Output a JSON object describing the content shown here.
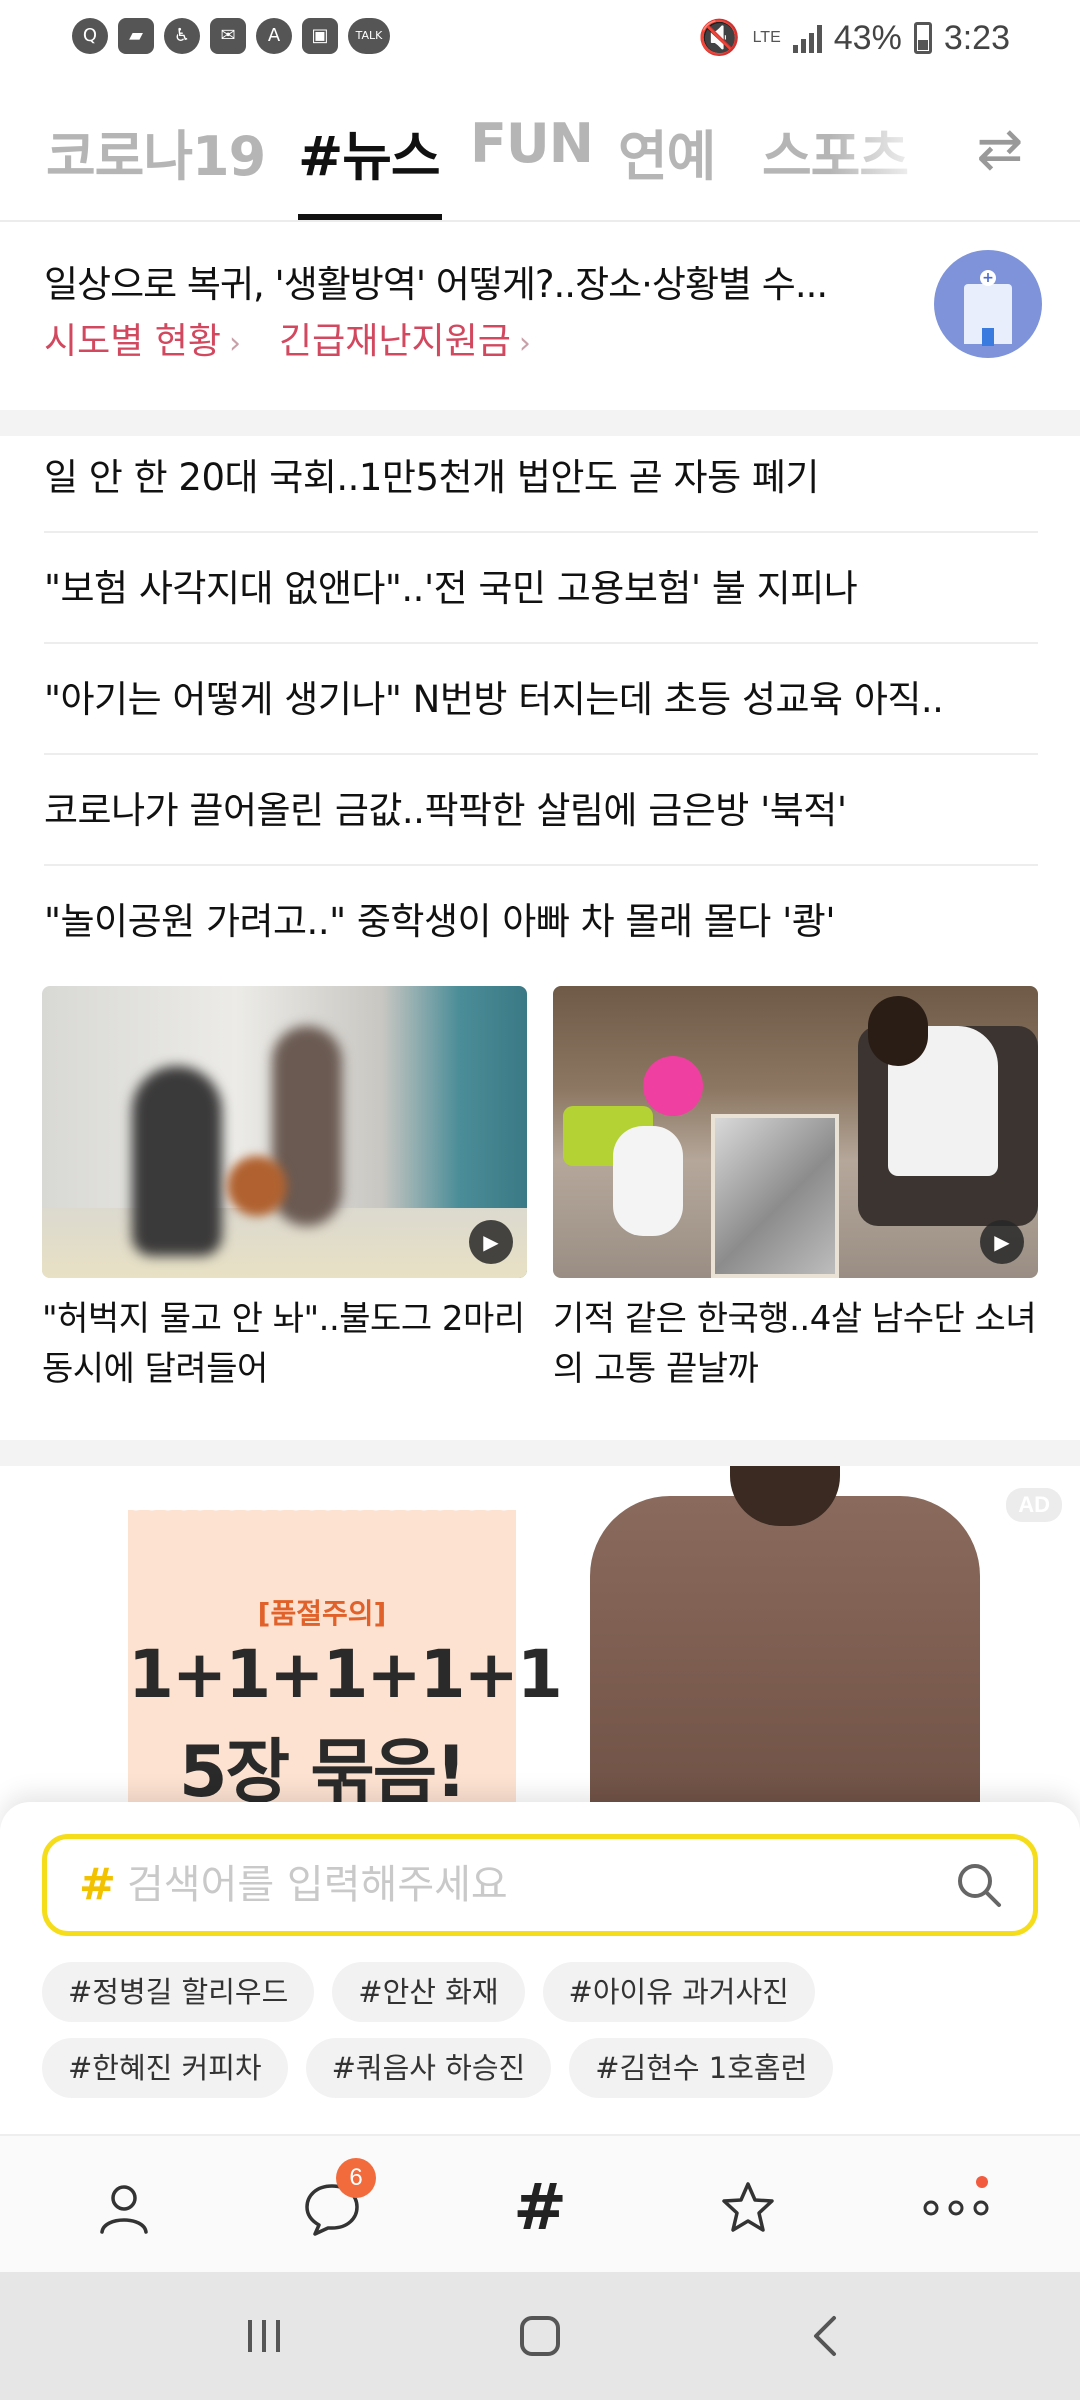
{
  "status_bar": {
    "left_icons": [
      "q-app-icon",
      "shopping-bag-icon",
      "accessibility-icon",
      "mail-icon",
      "a-app-icon",
      "gallery-icon",
      "kakaotalk-icon"
    ],
    "talk_label": "TALK",
    "network": "LTE",
    "battery": "43%",
    "time": "3:23"
  },
  "tabs": [
    {
      "label": "코로나19"
    },
    {
      "label": "#뉴스"
    },
    {
      "label": "FUN"
    },
    {
      "label": "연예"
    },
    {
      "label": "스포츠"
    }
  ],
  "active_tab": 1,
  "banner": {
    "title": "일상으로 복귀, '생활방역' 어떻게?..장소·상황별 수...",
    "links": [
      {
        "label": "시도별 현황"
      },
      {
        "label": "긴급재난지원금"
      }
    ],
    "icon": "hospital-icon"
  },
  "headlines": [
    {
      "title": "일 안 한 20대 국회..1만5천개 법안도 곧 자동 폐기"
    },
    {
      "title": "\"보험 사각지대 없앤다\"..'전 국민 고용보험' 불 지피나"
    },
    {
      "title": "\"아기는 어떻게 생기나\" N번방 터지는데 초등 성교육 아직.."
    },
    {
      "title": "코로나가 끌어올린 금값..팍팍한 살림에 금은방 '북적'"
    },
    {
      "title": "\"놀이공원 가려고..\" 중학생이 아빠 차 몰래 몰다 '쾅'"
    }
  ],
  "photo_cards": [
    {
      "caption": "\"허벅지 물고 안 놔\"..불도그 2마리 동시에 달려들어"
    },
    {
      "caption": "기적 같은 한국행..4살 남수단 소녀의 고통 끝날까"
    }
  ],
  "ad": {
    "badge": "AD",
    "warning": "[품절주의]",
    "line1": "1+1+1+1+1",
    "line2": "5장 묶음!"
  },
  "search": {
    "hash": "#",
    "placeholder": "검색어를 입력해주세요",
    "value": ""
  },
  "trending_tags": [
    [
      "#정병길 할리우드",
      "#안산 화재",
      "#아이유 과거사진"
    ],
    [
      "#한혜진 커피차",
      "#쿼음사 하승진",
      "#김현수 1호홈런"
    ]
  ],
  "bottom_nav": {
    "items": [
      "profile-icon",
      "chat-icon",
      "hashtag-icon",
      "star-icon",
      "more-icon"
    ],
    "chat_badge": "6",
    "hash_label": "#"
  },
  "colors": {
    "accent_yellow": "#f5dd1b",
    "link_red": "#d2485f",
    "badge_orange": "#f16b3d"
  }
}
